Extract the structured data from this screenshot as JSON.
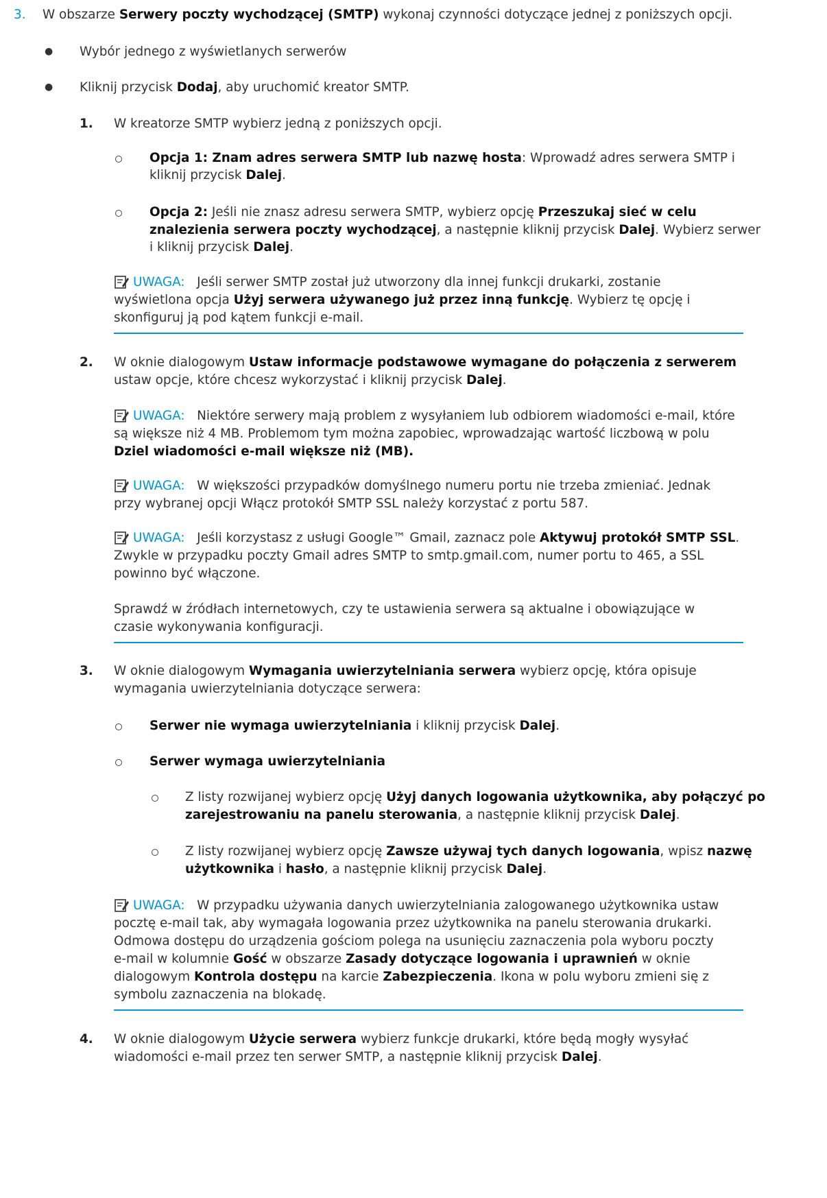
{
  "step3": {
    "number": "3.",
    "t1": "W obszarze ",
    "b1": "Serwery poczty wychodzącej (SMTP)",
    "t2": " wykonaj czynności dotyczące jednej z poniższych opcji."
  },
  "bullets": {
    "b1": "Wybór jednego z wyświetlanych serwerów",
    "b2_t1": "Kliknij przycisk ",
    "b2_b1": "Dodaj",
    "b2_t2": ", aby uruchomić kreator SMTP."
  },
  "sub1": {
    "number": "1.",
    "text": "W kreatorze SMTP wybierz jedną z poniższych opcji.",
    "opt1": {
      "b1": "Opcja 1: Znam adres serwera SMTP lub nazwę hosta",
      "t1": ": Wprowadź adres serwera SMTP i",
      "t2": "kliknij przycisk ",
      "b2": "Dalej",
      "t3": "."
    },
    "opt2": {
      "b1": "Opcja 2:",
      "t1": " Jeśli nie znasz adresu serwera SMTP, wybierz opcję ",
      "b2": "Przeszukaj sieć w celu",
      "b3": "znalezienia serwera poczty wychodzącej",
      "t2": ", a następnie kliknij przycisk ",
      "b4": "Dalej",
      "t3": ". Wybierz serwer",
      "t4": "i kliknij przycisk ",
      "b5": "Dalej",
      "t5": "."
    },
    "note": {
      "label": "UWAGA:",
      "t1": "Jeśli serwer SMTP został już utworzony dla innej funkcji drukarki, zostanie",
      "t2": "wyświetlona opcja ",
      "b1": "Użyj serwera używanego już przez inną funkcję",
      "t3": ". Wybierz tę opcję i",
      "t4": "skonfiguruj ją pod kątem funkcji e-mail."
    }
  },
  "sub2": {
    "number": "2.",
    "t1": "W oknie dialogowym ",
    "b1": "Ustaw informacje podstawowe wymagane do połączenia z serwerem",
    "t2": "ustaw opcje, które chcesz wykorzystać i kliknij przycisk ",
    "b2": "Dalej",
    "t3": ".",
    "note1": {
      "label": "UWAGA:",
      "t1": "Niektóre serwery mają problem z wysyłaniem lub odbiorem wiadomości e-mail, które",
      "t2": "są większe niż 4 MB. Problemom tym można zapobiec, wprowadzając wartość liczbową w polu",
      "b1": "Dziel wiadomości e-mail większe niż (MB)."
    },
    "note2": {
      "label": "UWAGA:",
      "t1": "W większości przypadków domyślnego numeru portu nie trzeba zmieniać. Jednak",
      "t2": "przy wybranej opcji Włącz protokół SMTP SSL należy korzystać z portu 587."
    },
    "note3": {
      "label": "UWAGA:",
      "t1": "Jeśli korzystasz z usługi Google™ Gmail, zaznacz pole ",
      "b1": "Aktywuj protokół SMTP SSL",
      "t2": ".",
      "t3": "Zwykle w przypadku poczty Gmail adres SMTP to smtp.gmail.com, numer portu to 465, a SSL",
      "t4": "powinno być włączone.",
      "t5": "Sprawdź w źródłach internetowych, czy te ustawienia serwera są aktualne i obowiązujące w",
      "t6": "czasie wykonywania konfiguracji."
    }
  },
  "sub3": {
    "number": "3.",
    "t1": "W oknie dialogowym ",
    "b1": "Wymagania uwierzytelniania serwera",
    "t2": " wybierz opcję, która opisuje",
    "t3": "wymagania uwierzytelniania dotyczące serwera:",
    "opt1": {
      "b1": "Serwer nie wymaga uwierzytelniania",
      "t1": " i kliknij przycisk ",
      "b2": "Dalej",
      "t2": "."
    },
    "opt2": {
      "b1": "Serwer wymaga uwierzytelniania"
    },
    "sub_a": {
      "t1": "Z listy rozwijanej wybierz opcję ",
      "b1": "Użyj danych logowania użytkownika, aby połączyć po",
      "b2": "zarejestrowaniu na panelu sterowania",
      "t2": ", a następnie kliknij przycisk ",
      "b3": "Dalej",
      "t3": "."
    },
    "sub_b": {
      "t1": "Z listy rozwijanej wybierz opcję ",
      "b1": "Zawsze używaj tych danych logowania",
      "t2": ", wpisz ",
      "b2": "nazwę",
      "b3": "użytkownika",
      "t3": " i ",
      "b4": "hasło",
      "t4": ", a następnie kliknij przycisk ",
      "b5": "Dalej",
      "t5": "."
    },
    "note": {
      "label": "UWAGA:",
      "t1": "W przypadku używania danych uwierzytelniania zalogowanego użytkownika ustaw",
      "t2": "pocztę e-mail tak, aby wymagała logowania przez użytkownika na panelu sterowania drukarki.",
      "t3": "Odmowa dostępu do urządzenia gościom polega na usunięciu zaznaczenia pola wyboru poczty",
      "t4": "e-mail w kolumnie ",
      "b1": "Gość",
      "t5": " w obszarze ",
      "b2": "Zasady dotyczące logowania i uprawnień",
      "t6": " w oknie",
      "t7": "dialogowym ",
      "b3": "Kontrola dostępu",
      "t8": " na karcie ",
      "b4": "Zabezpieczenia",
      "t9": ". Ikona w polu wyboru zmieni się z",
      "t10": "symbolu zaznaczenia na blokadę."
    }
  },
  "sub4": {
    "number": "4.",
    "t1": "W oknie dialogowym ",
    "b1": "Użycie serwera",
    "t2": " wybierz funkcje drukarki, które będą mogły wysyłać",
    "t3": "wiadomości e-mail przez ten serwer SMTP, a następnie kliknij przycisk ",
    "b2": "Dalej",
    "t4": "."
  }
}
